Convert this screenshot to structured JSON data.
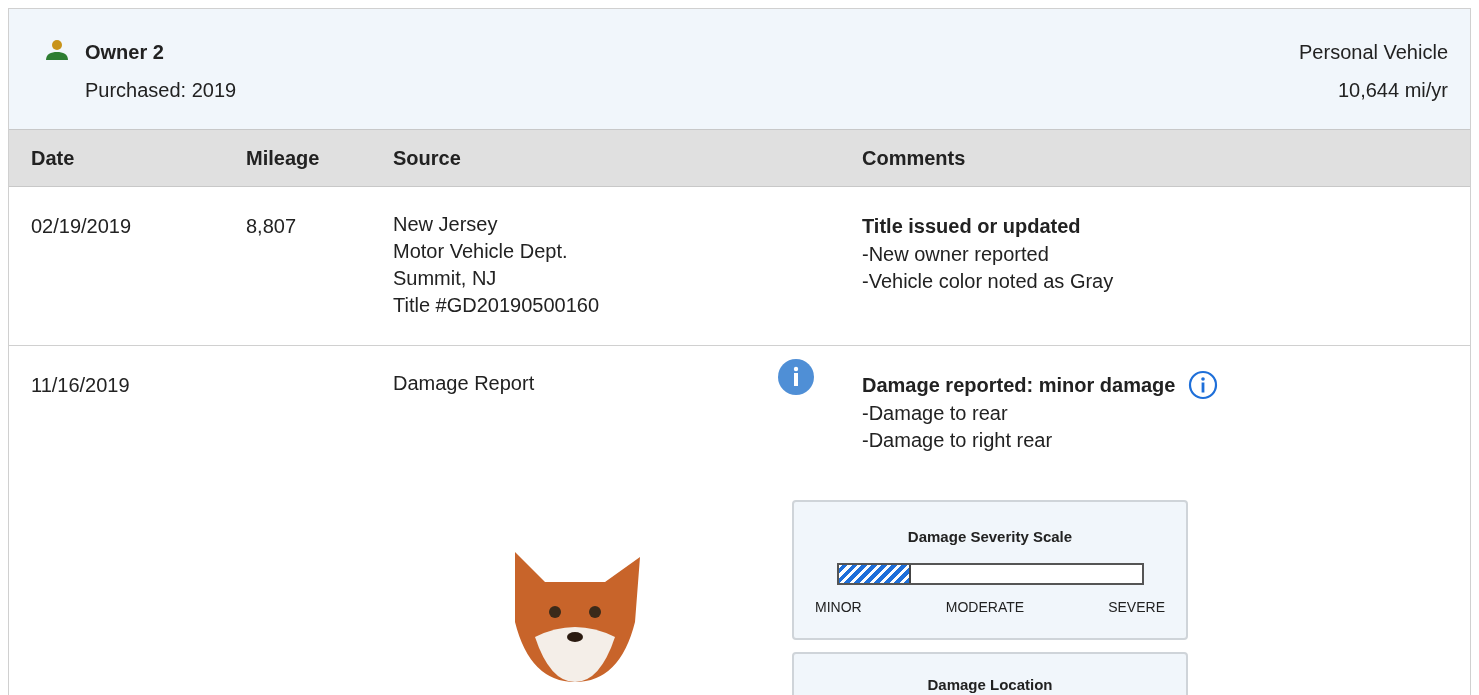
{
  "owner": {
    "name": "Owner 2",
    "purchased": "Purchased: 2019",
    "use": "Personal Vehicle",
    "mileage_rate": "10,644 mi/yr"
  },
  "table": {
    "columns": [
      "Date",
      "Mileage",
      "Source",
      "Comments"
    ],
    "rows": [
      {
        "date": "02/19/2019",
        "mileage": "8,807",
        "source": [
          "New Jersey",
          "Motor Vehicle Dept.",
          "Summit, NJ",
          "Title #GD20190500160"
        ],
        "source_info": false,
        "title": "Title issued or updated",
        "title_info": false,
        "details": [
          "-New owner reported",
          "-Vehicle color noted as Gray"
        ]
      },
      {
        "date": "11/16/2019",
        "source": [
          "Damage Report"
        ],
        "source_info": true,
        "title": "Damage reported: minor damage",
        "title_info": true,
        "details": [
          "-Damage to rear",
          "-Damage to right rear"
        ],
        "severity": {
          "title": "Damage Severity Scale",
          "level": 0.24,
          "labels": [
            "MINOR",
            "MODERATE",
            "SEVERE"
          ]
        },
        "location": {
          "title": "Damage Location"
        },
        "mascot": true
      }
    ]
  }
}
